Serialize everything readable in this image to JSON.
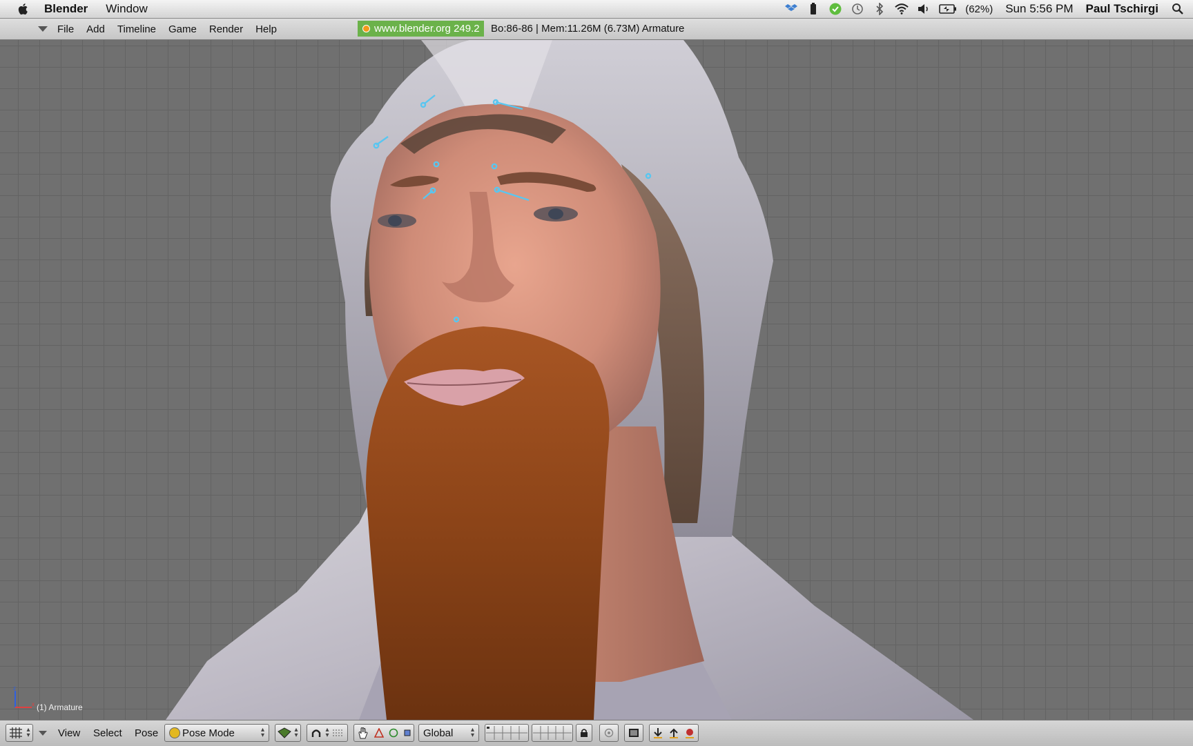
{
  "mac_menubar": {
    "app_name": "Blender",
    "menus": [
      "Window"
    ],
    "battery": "(62%)",
    "clock": "Sun 5:56 PM",
    "user": "Paul Tschirgi"
  },
  "blender_header": {
    "menus": [
      "File",
      "Add",
      "Timeline",
      "Game",
      "Render",
      "Help"
    ],
    "website": "www.blender.org 249.2",
    "stats": "Bo:86-86  | Mem:11.26M (6.73M) Armature"
  },
  "viewport": {
    "object_label": "(1) Armature",
    "grid_color": "#636363",
    "background_color": "#707070",
    "bone_color": "#59c6f0"
  },
  "bottom_toolbar": {
    "menus": [
      "View",
      "Select",
      "Pose"
    ],
    "mode": "Pose Mode",
    "orientation": "Global"
  },
  "icons": [
    "apple-icon",
    "dropbox-icon",
    "battery-icon",
    "evernote-icon",
    "time-machine-icon",
    "bluetooth-icon",
    "wifi-icon",
    "volume-icon",
    "spotlight-icon",
    "grid-icon",
    "pivot-icon",
    "snap-icon",
    "hand-icon",
    "lock-icon"
  ]
}
